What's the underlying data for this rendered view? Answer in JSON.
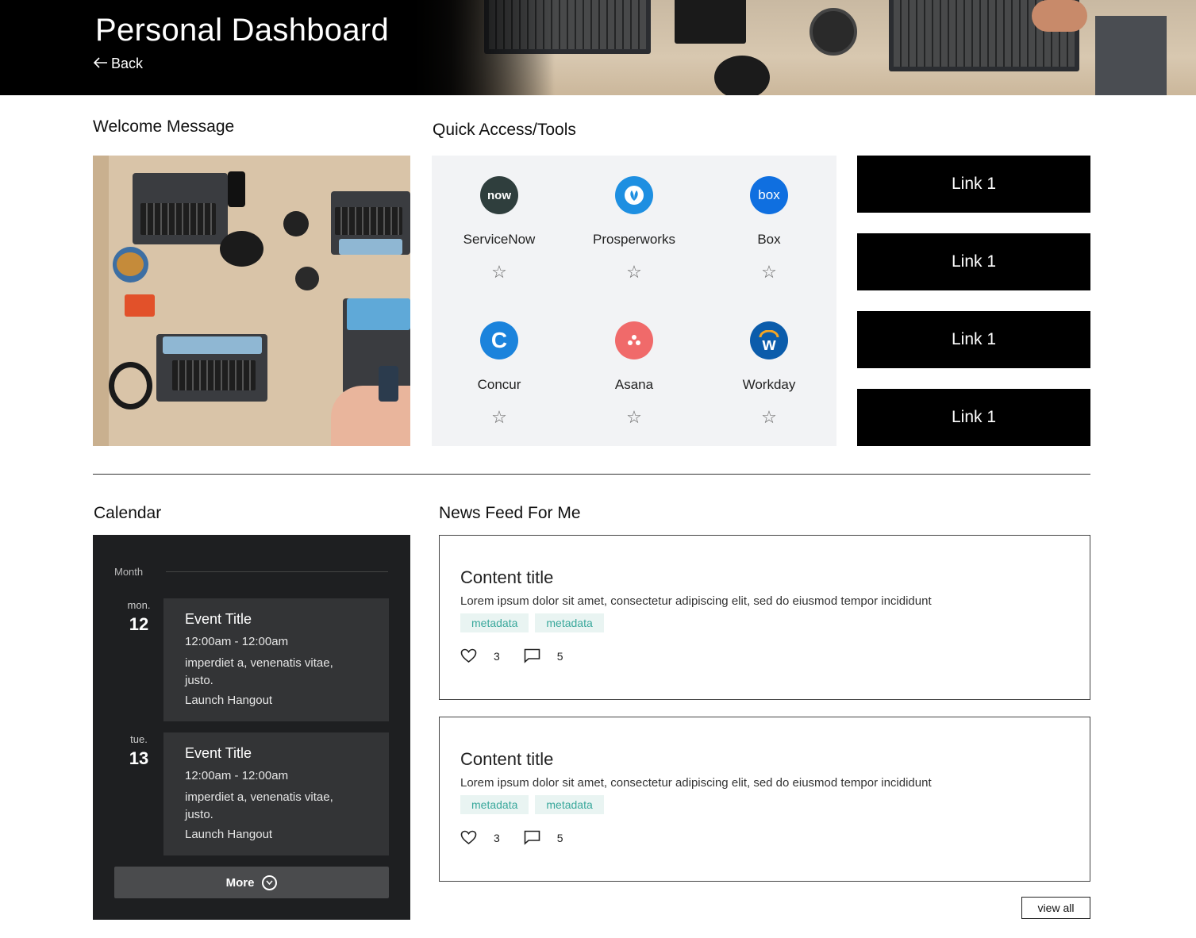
{
  "header": {
    "title": "Personal Dashboard",
    "back_label": "Back"
  },
  "welcome": {
    "title": "Welcome Message"
  },
  "tools": {
    "title": "Quick Access/Tools",
    "items": [
      {
        "name": "ServiceNow",
        "icon": "servicenow-icon",
        "icon_text": "now",
        "color": "#2f3e3d"
      },
      {
        "name": "Prosperworks",
        "icon": "prosperworks-icon",
        "icon_text": "",
        "color": "#1e8fe1"
      },
      {
        "name": "Box",
        "icon": "box-icon",
        "icon_text": "box",
        "color": "#0f6fe0"
      },
      {
        "name": "Concur",
        "icon": "concur-icon",
        "icon_text": "C",
        "color": "#1b83dc"
      },
      {
        "name": "Asana",
        "icon": "asana-icon",
        "icon_text": "",
        "color": "#f06a6a"
      },
      {
        "name": "Workday",
        "icon": "workday-icon",
        "icon_text": "w",
        "color": "#0b5cab"
      }
    ]
  },
  "links": [
    "Link 1",
    "Link 1",
    "Link 1",
    "Link 1"
  ],
  "calendar": {
    "title": "Calendar",
    "month_label": "Month",
    "days": [
      {
        "dow": "mon.",
        "num": "12",
        "event_title": "Event Title",
        "time": "12:00am - 12:00am",
        "desc": "imperdiet a, venenatis vitae, justo.",
        "link": "Launch Hangout"
      },
      {
        "dow": "tue.",
        "num": "13",
        "event_title": "Event Title",
        "time": "12:00am - 12:00am",
        "desc": "imperdiet a, venenatis vitae, justo.",
        "link": "Launch Hangout"
      }
    ],
    "more_label": "More"
  },
  "news": {
    "title": "News Feed For Me",
    "items": [
      {
        "title": "Content title",
        "body": "Lorem ipsum dolor sit amet, consectetur adipiscing elit, sed do eiusmod tempor incididunt",
        "tags": [
          "metadata",
          "metadata"
        ],
        "likes": "3",
        "comments": "5"
      },
      {
        "title": "Content title",
        "body": "Lorem ipsum dolor sit amet, consectetur adipiscing elit, sed do eiusmod tempor incididunt",
        "tags": [
          "metadata",
          "metadata"
        ],
        "likes": "3",
        "comments": "5"
      }
    ],
    "view_all_label": "view all"
  }
}
